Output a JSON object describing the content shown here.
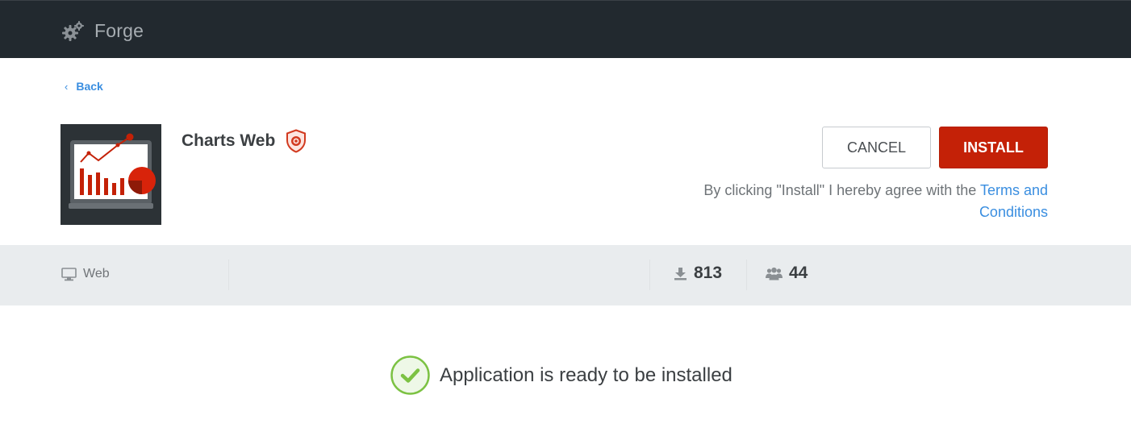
{
  "header": {
    "brand_name": "Forge",
    "brand_icon": "gears-icon",
    "background": "#22292f"
  },
  "nav": {
    "back_label": "Back",
    "back_icon": "chevron-left-icon"
  },
  "app": {
    "title": "Charts Web",
    "badge_icon": "shield-target-icon",
    "logo_icon": "laptop-chart-icon"
  },
  "actions": {
    "cancel_label": "CANCEL",
    "install_label": "INSTALL",
    "agree_text": "By clicking \"Install\" I hereby agree with the",
    "terms_link": "Terms and Conditions",
    "install_color": "#c42107"
  },
  "info": {
    "platform_label": "Web",
    "platform_icon": "monitor-icon",
    "downloads": "813",
    "downloads_icon": "download-icon",
    "users": "44",
    "users_icon": "users-icon"
  },
  "status": {
    "message": "Application is ready to be installed",
    "icon": "check-circle-icon",
    "color": "#7cc243"
  }
}
